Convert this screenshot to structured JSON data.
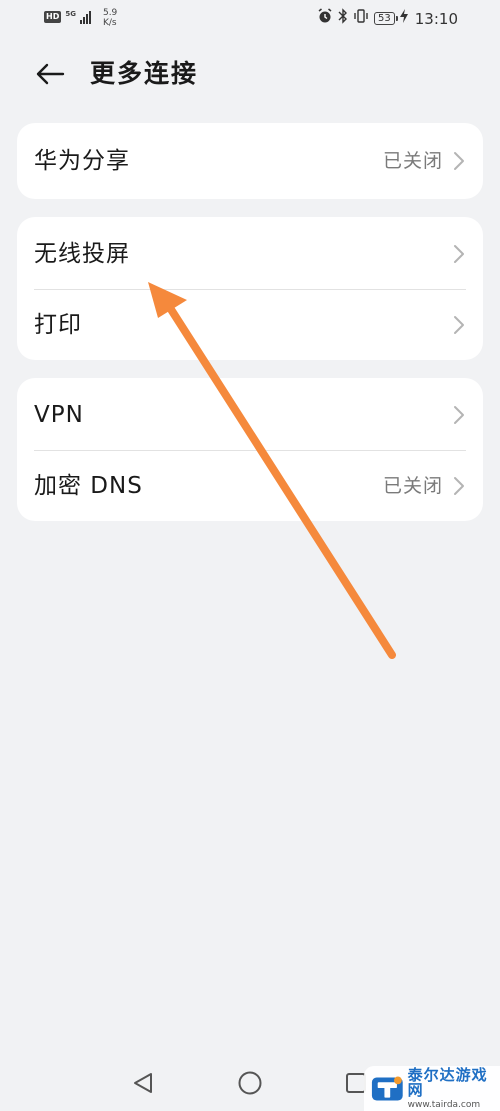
{
  "status_bar": {
    "hd": "HD",
    "network": "5G",
    "speed_value": "5.9",
    "speed_unit": "K/s",
    "battery": "53",
    "time": "13:10"
  },
  "header": {
    "title": "更多连接"
  },
  "cards": [
    {
      "rows": [
        {
          "label": "华为分享",
          "value": "已关闭"
        }
      ]
    },
    {
      "rows": [
        {
          "label": "无线投屏",
          "value": ""
        },
        {
          "label": "打印",
          "value": ""
        }
      ]
    },
    {
      "rows": [
        {
          "label": "VPN",
          "value": ""
        },
        {
          "label": "加密 DNS",
          "value": "已关闭"
        }
      ]
    }
  ],
  "annotation": {
    "color": "#f5893c"
  },
  "watermark": {
    "name": "泰尔达游戏网",
    "url": "www.tairda.com"
  },
  "colors": {
    "background": "#f1f2f4",
    "card": "#ffffff",
    "secondary_text": "#7a7a7a"
  }
}
